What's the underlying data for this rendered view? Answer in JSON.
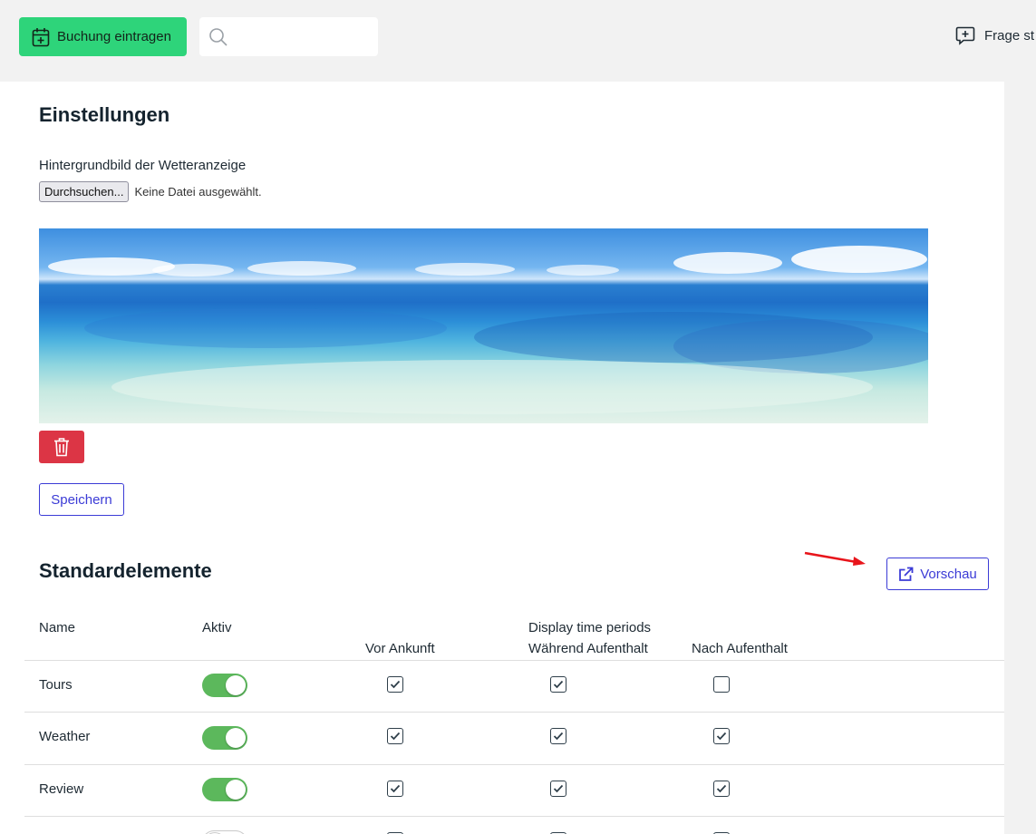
{
  "header": {
    "booking_button_label": "Buchung eintragen",
    "search_placeholder": "",
    "ask_question_label": "Frage st"
  },
  "settings": {
    "title": "Einstellungen",
    "background_label": "Hintergrundbild der Wetteranzeige",
    "browse_button_label": "Durchsuchen...",
    "no_file_label": "Keine Datei ausgewählt.",
    "save_label": "Speichern"
  },
  "standard_elements": {
    "title": "Standardelemente",
    "preview_label": "Vorschau",
    "columns": {
      "name": "Name",
      "active": "Aktiv",
      "periods": "Display time periods",
      "before_arrival": "Vor Ankunft",
      "during_stay": "Während Aufenthalt",
      "after_stay": "Nach Aufenthalt"
    },
    "rows": [
      {
        "name": "Tours",
        "active": true,
        "before_arrival": true,
        "during_stay": true,
        "after_stay": false
      },
      {
        "name": "Weather",
        "active": true,
        "before_arrival": true,
        "during_stay": true,
        "after_stay": true
      },
      {
        "name": "Review",
        "active": true,
        "before_arrival": true,
        "during_stay": true,
        "after_stay": true
      },
      {
        "name": "",
        "active": false,
        "before_arrival": true,
        "during_stay": true,
        "after_stay": true
      }
    ]
  },
  "colors": {
    "primary_green": "#2ed47a",
    "accent_blue": "#3b3bd6",
    "danger_red": "#dc3545",
    "toggle_on": "#5cb85c",
    "annotation_arrow": "#e8151b"
  }
}
